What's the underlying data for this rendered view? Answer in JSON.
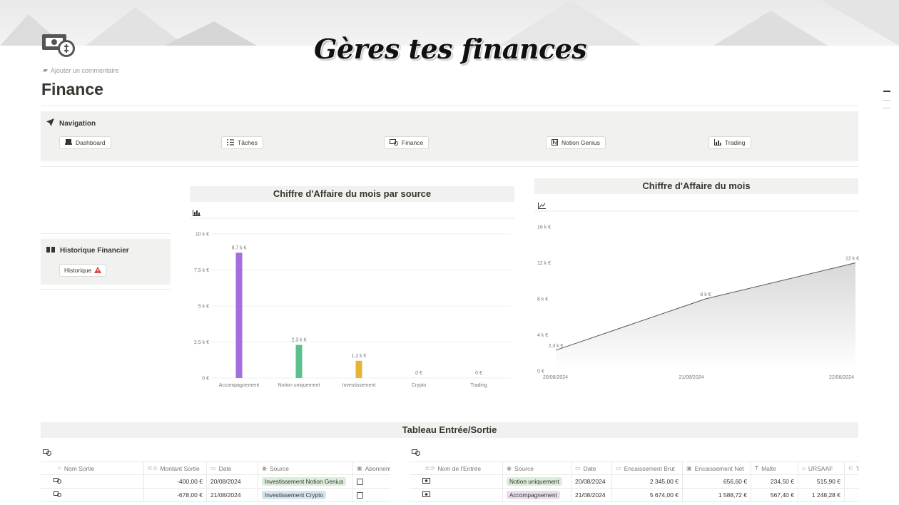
{
  "header": {
    "banner_title": "Gères tes finances",
    "add_comment": "Ajouter un commentaire",
    "page_title": "Finance",
    "page_icon": "money-wing-icon"
  },
  "navigation": {
    "heading": "Navigation",
    "items": [
      {
        "label": "Dashboard",
        "icon": "laptop-icon"
      },
      {
        "label": "Tâches",
        "icon": "checklist-icon"
      },
      {
        "label": "Finance",
        "icon": "money-icon"
      },
      {
        "label": "Notion Genius",
        "icon": "notion-icon"
      },
      {
        "label": "Trading",
        "icon": "chart-icon"
      }
    ]
  },
  "historique": {
    "heading": "Historique Financier",
    "button": "Historique",
    "button_icon": "warning-icon"
  },
  "chart_data": [
    {
      "type": "bar",
      "title": "Chiffre d'Affaire du mois par source",
      "categories": [
        "Accompagnement",
        "Notion uniquement",
        "Investissement",
        "Crypto",
        "Trading"
      ],
      "values": [
        8700,
        2300,
        1200,
        0,
        0
      ],
      "value_labels": [
        "8,7 k €",
        "2,3 k €",
        "1,2 k €",
        "0 €",
        "0 €"
      ],
      "colors": [
        "#a46fdc",
        "#5bbf8e",
        "#e5b439",
        "#a46fdc",
        "#a46fdc"
      ],
      "yticks": [
        "0 €",
        "2,5 k €",
        "5 k €",
        "7,5 k €",
        "10 k €"
      ],
      "ylim": [
        0,
        10000
      ]
    },
    {
      "type": "area",
      "title": "Chiffre d'Affaire du mois",
      "x": [
        "20/08/2024",
        "21/08/2024",
        "22/08/2024"
      ],
      "values": [
        2300,
        8000,
        12000
      ],
      "value_labels": [
        "2,3 k €",
        "8 k €",
        "12 k €"
      ],
      "yticks": [
        "0 €",
        "4 k €",
        "8 k €",
        "12 k €",
        "16 k €"
      ],
      "ylim": [
        0,
        16000
      ]
    }
  ],
  "table_section": {
    "title": "Tableau Entrée/Sortie",
    "sorties": {
      "columns": [
        "Nom Sortie",
        "Montant Sortie",
        "Date",
        "Source",
        "Abonnem"
      ],
      "rows": [
        {
          "montant": "-400,00 €",
          "date": "20/08/2024",
          "source": "Investissement Notion Genius",
          "color": "green"
        },
        {
          "montant": "-678,00 €",
          "date": "21/08/2024",
          "source": "Investissement Crypto",
          "color": "blue"
        }
      ]
    },
    "entrees": {
      "columns": [
        "Nom de l'Entrée",
        "Source",
        "Date",
        "Encaissement Brut",
        "Encaissement Net",
        "Malte",
        "URSAAF",
        "T"
      ],
      "rows": [
        {
          "source": "Notion uniquement",
          "color": "green",
          "date": "20/08/2024",
          "brut": "2 345,00 €",
          "net": "656,60 €",
          "malte": "234,50 €",
          "ursaaf": "515,90 €"
        },
        {
          "source": "Accompagnement",
          "color": "purple",
          "date": "21/08/2024",
          "brut": "5 674,00 €",
          "net": "1 588,72 €",
          "malte": "567,40 €",
          "ursaaf": "1 248,28 €"
        }
      ]
    }
  }
}
